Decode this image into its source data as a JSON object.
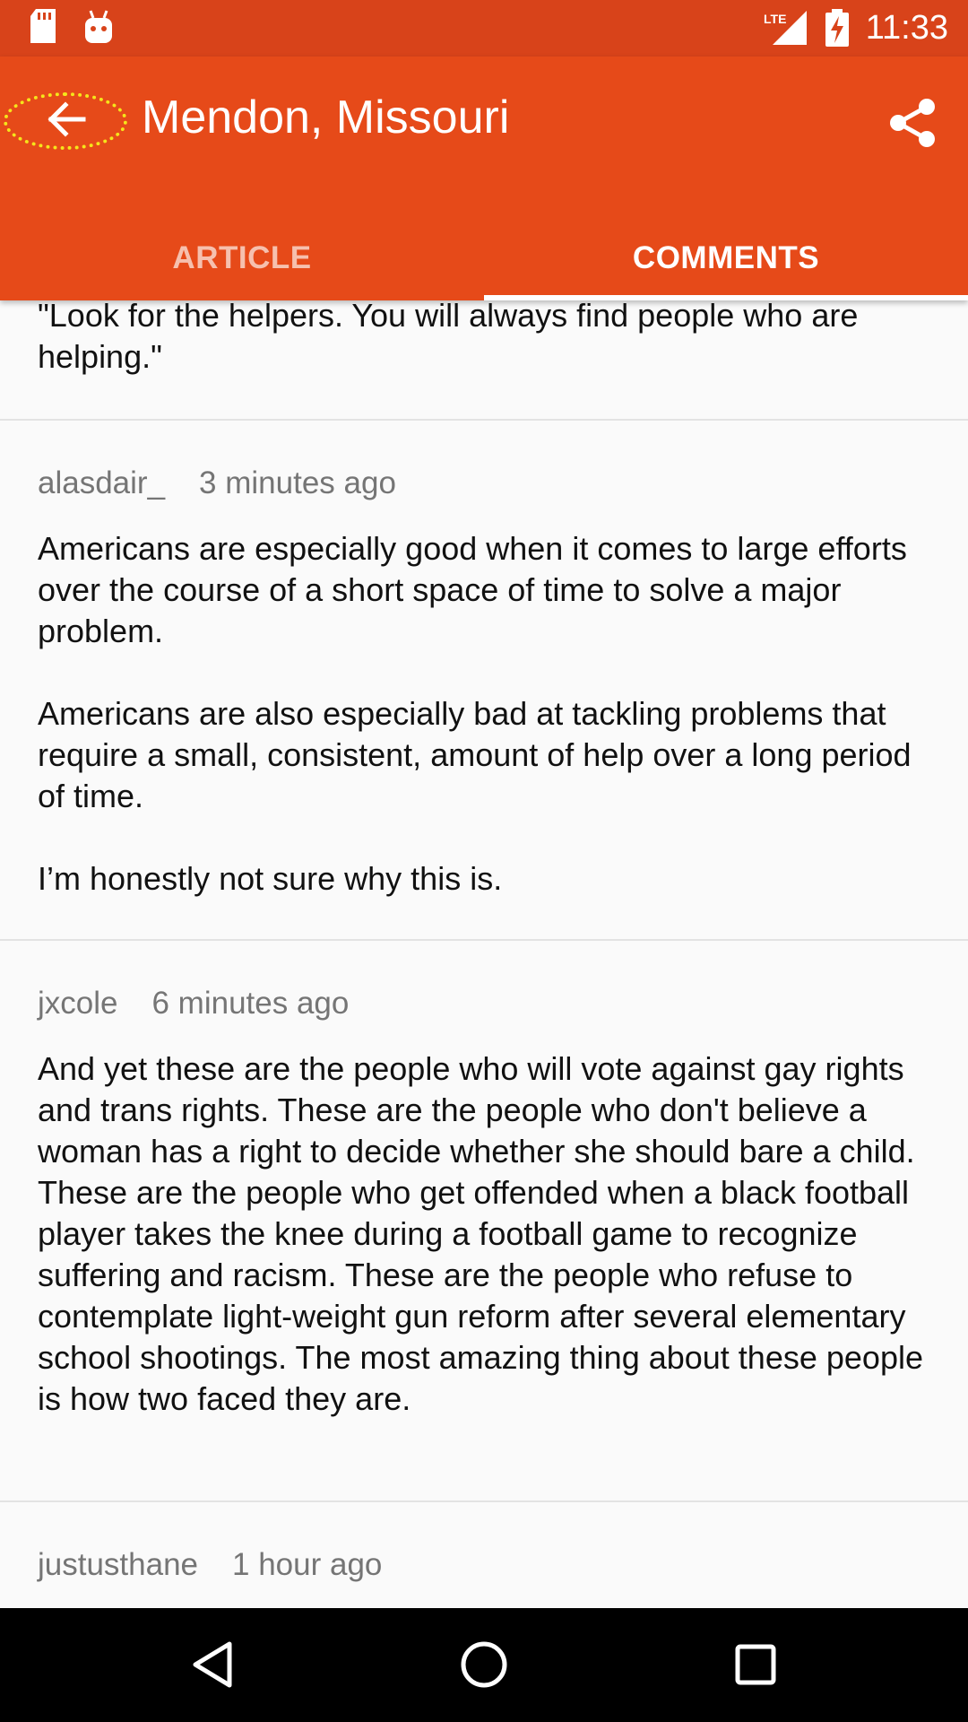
{
  "status_bar": {
    "time": "11:33",
    "network": "LTE",
    "icons": [
      "sd-card-icon",
      "android-icon",
      "lte-signal-icon",
      "battery-charging-icon"
    ]
  },
  "app_bar": {
    "title": "Mendon, Missouri",
    "back_icon": "arrow-back-icon",
    "share_icon": "share-icon",
    "tabs": [
      {
        "label": "ARTICLE",
        "selected": false
      },
      {
        "label": "COMMENTS",
        "selected": true
      }
    ],
    "colors": {
      "primary": "#e64a19",
      "status": "#d8431a",
      "highlight": "#f5e51b"
    }
  },
  "comments": {
    "partial_top_text": "\"Look for the helpers. You will always find people who are helping.\"",
    "items": [
      {
        "author": "alasdair_",
        "time": "3 minutes ago",
        "text": "Americans are especially good when it comes to large efforts over the course of a short space of time to solve a major problem.\n\nAmericans are also especially bad at tackling problems that require a small, consistent, amount of help over a long period of time.\n\nI’m honestly not sure why this is."
      },
      {
        "author": "jxcole",
        "time": "6 minutes ago",
        "text": "And yet these are the people who will vote against gay rights and trans rights. These are the people who don't believe a woman has a right to decide whether she should bare a child. These are the people who get offended when a black football player takes the knee during a football game to recognize suffering and racism. These are the people who refuse to contemplate light-weight gun reform after several elementary school shootings. The most amazing thing about these people is how two faced they are."
      },
      {
        "author": "justusthane",
        "time": "1 hour ago"
      }
    ]
  },
  "nav_bar": {
    "icons": [
      "back-triangle-icon",
      "home-circle-icon",
      "recents-square-icon"
    ]
  }
}
